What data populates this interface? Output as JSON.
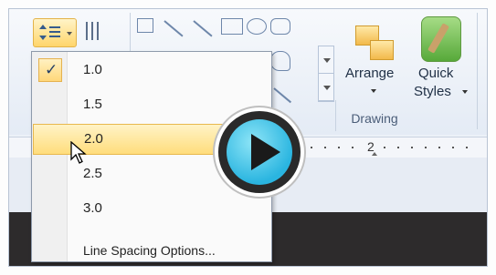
{
  "ribbon": {
    "arrange_label": "Arrange",
    "quick_styles_line1": "Quick",
    "quick_styles_line2": "Styles",
    "group_label": "Drawing"
  },
  "ruler": {
    "visible_number": "2"
  },
  "line_spacing_menu": {
    "items": [
      {
        "label": "1.0",
        "checked": true
      },
      {
        "label": "1.5",
        "checked": false
      },
      {
        "label": "2.0",
        "checked": false,
        "hovered": true
      },
      {
        "label": "2.5",
        "checked": false
      },
      {
        "label": "3.0",
        "checked": false
      }
    ],
    "options_label": "Line Spacing Options..."
  },
  "check_glyph": "✓",
  "icons": [
    "line-spacing-icon",
    "columns-icon",
    "shapes-gallery",
    "arrange-icon",
    "quick-styles-icon",
    "play-icon",
    "mouse-pointer-icon",
    "checkmark-icon"
  ],
  "colors": {
    "highlight": "#ffdd7c",
    "play_accent": "#2ab5e0"
  }
}
